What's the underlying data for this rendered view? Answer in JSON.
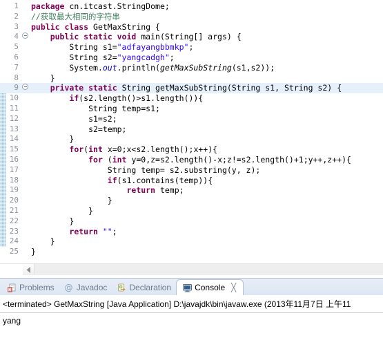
{
  "editor": {
    "change_bar_from_line": 9,
    "change_bar_to_line": 24,
    "current_line": 9,
    "lines": [
      {
        "n": "1",
        "fold": false,
        "tokens": [
          {
            "t": "kw",
            "v": "package"
          },
          {
            "t": "pln",
            "v": " cn.itcast.StringDome;"
          }
        ]
      },
      {
        "n": "2",
        "fold": false,
        "tokens": [
          {
            "t": "cmt",
            "v": "//获取最大相同的字符串"
          }
        ]
      },
      {
        "n": "3",
        "fold": false,
        "tokens": [
          {
            "t": "kw",
            "v": "public class"
          },
          {
            "t": "pln",
            "v": " GetMaxString {"
          }
        ]
      },
      {
        "n": "4",
        "fold": true,
        "tokens": [
          {
            "t": "pln",
            "v": "    "
          },
          {
            "t": "kw",
            "v": "public static void"
          },
          {
            "t": "pln",
            "v": " main(String[] args) {"
          }
        ]
      },
      {
        "n": "5",
        "fold": false,
        "tokens": [
          {
            "t": "pln",
            "v": "        String s1="
          },
          {
            "t": "str",
            "v": "\"adfayangbbmkp\""
          },
          {
            "t": "pln",
            "v": ";"
          }
        ]
      },
      {
        "n": "6",
        "fold": false,
        "tokens": [
          {
            "t": "pln",
            "v": "        String s2="
          },
          {
            "t": "str",
            "v": "\"yangcadgh\""
          },
          {
            "t": "pln",
            "v": ";"
          }
        ]
      },
      {
        "n": "7",
        "fold": false,
        "tokens": [
          {
            "t": "pln",
            "v": "        System."
          },
          {
            "t": "fld",
            "v": "out"
          },
          {
            "t": "pln",
            "v": ".println("
          },
          {
            "t": "mth",
            "v": "getMaxSubString"
          },
          {
            "t": "pln",
            "v": "(s1,s2));"
          }
        ]
      },
      {
        "n": "8",
        "fold": false,
        "tokens": [
          {
            "t": "pln",
            "v": "    }"
          }
        ]
      },
      {
        "n": "9",
        "fold": true,
        "tokens": [
          {
            "t": "pln",
            "v": "    "
          },
          {
            "t": "kw",
            "v": "private static"
          },
          {
            "t": "pln",
            "v": " String getMaxSubString(String s1, String s2) {"
          }
        ]
      },
      {
        "n": "10",
        "fold": false,
        "tokens": [
          {
            "t": "pln",
            "v": "        "
          },
          {
            "t": "kw",
            "v": "if"
          },
          {
            "t": "pln",
            "v": "(s2.length()>s1.length()){"
          }
        ]
      },
      {
        "n": "11",
        "fold": false,
        "tokens": [
          {
            "t": "pln",
            "v": "            String temp=s1;"
          }
        ]
      },
      {
        "n": "12",
        "fold": false,
        "tokens": [
          {
            "t": "pln",
            "v": "            s1=s2;"
          }
        ]
      },
      {
        "n": "13",
        "fold": false,
        "tokens": [
          {
            "t": "pln",
            "v": "            s2=temp;"
          }
        ]
      },
      {
        "n": "14",
        "fold": false,
        "tokens": [
          {
            "t": "pln",
            "v": "        }"
          }
        ]
      },
      {
        "n": "15",
        "fold": false,
        "tokens": [
          {
            "t": "pln",
            "v": "        "
          },
          {
            "t": "kw",
            "v": "for"
          },
          {
            "t": "pln",
            "v": "("
          },
          {
            "t": "kw",
            "v": "int"
          },
          {
            "t": "pln",
            "v": " x=0;x<s2.length();x++){"
          }
        ]
      },
      {
        "n": "16",
        "fold": false,
        "tokens": [
          {
            "t": "pln",
            "v": "            "
          },
          {
            "t": "kw",
            "v": "for"
          },
          {
            "t": "pln",
            "v": " ("
          },
          {
            "t": "kw",
            "v": "int"
          },
          {
            "t": "pln",
            "v": " y=0,z=s2.length()-x;z!=s2.length()+1;y++,z++){"
          }
        ]
      },
      {
        "n": "17",
        "fold": false,
        "tokens": [
          {
            "t": "pln",
            "v": "                String temp= s2.substring(y, z);"
          }
        ]
      },
      {
        "n": "18",
        "fold": false,
        "tokens": [
          {
            "t": "pln",
            "v": "                "
          },
          {
            "t": "kw",
            "v": "if"
          },
          {
            "t": "pln",
            "v": "(s1.contains(temp)){"
          }
        ]
      },
      {
        "n": "19",
        "fold": false,
        "tokens": [
          {
            "t": "pln",
            "v": "                    "
          },
          {
            "t": "kw",
            "v": "return"
          },
          {
            "t": "pln",
            "v": " temp;"
          }
        ]
      },
      {
        "n": "20",
        "fold": false,
        "tokens": [
          {
            "t": "pln",
            "v": "                }"
          }
        ]
      },
      {
        "n": "21",
        "fold": false,
        "tokens": [
          {
            "t": "pln",
            "v": "            }"
          }
        ]
      },
      {
        "n": "22",
        "fold": false,
        "tokens": [
          {
            "t": "pln",
            "v": "        }"
          }
        ]
      },
      {
        "n": "23",
        "fold": false,
        "tokens": [
          {
            "t": "pln",
            "v": "        "
          },
          {
            "t": "kw",
            "v": "return"
          },
          {
            "t": "pln",
            "v": " "
          },
          {
            "t": "str",
            "v": "\"\""
          },
          {
            "t": "pln",
            "v": ";"
          }
        ]
      },
      {
        "n": "24",
        "fold": false,
        "tokens": [
          {
            "t": "pln",
            "v": "    }"
          }
        ]
      },
      {
        "n": "25",
        "fold": false,
        "tokens": [
          {
            "t": "pln",
            "v": "}"
          }
        ]
      }
    ]
  },
  "scrollbar": {
    "left_arrow_icon": "triangle-left-icon"
  },
  "bottom_panel": {
    "tabs": [
      {
        "label": "Problems",
        "icon": "problems-icon",
        "active": false,
        "closable": false
      },
      {
        "label": "Javadoc",
        "icon": "javadoc-at-icon",
        "active": false,
        "closable": false
      },
      {
        "label": "Declaration",
        "icon": "declaration-icon",
        "active": false,
        "closable": false
      },
      {
        "label": "Console",
        "icon": "console-icon",
        "active": true,
        "closable": true
      }
    ],
    "close_glyph": "╳"
  },
  "console": {
    "header": "<terminated> GetMaxString [Java Application] D:\\javajdk\\bin\\javaw.exe (2013年11月7日 上午11",
    "output": "yang"
  },
  "colors": {
    "keyword": "#7f0055",
    "string": "#2a00ff",
    "comment": "#3f7f5f",
    "field": "#0000c0",
    "current_line_bg": "#e6f0fb",
    "change_bar": "#9dc6e0",
    "tabbar_bg": "#dde6f3",
    "tab_border": "#b6c3d6"
  }
}
